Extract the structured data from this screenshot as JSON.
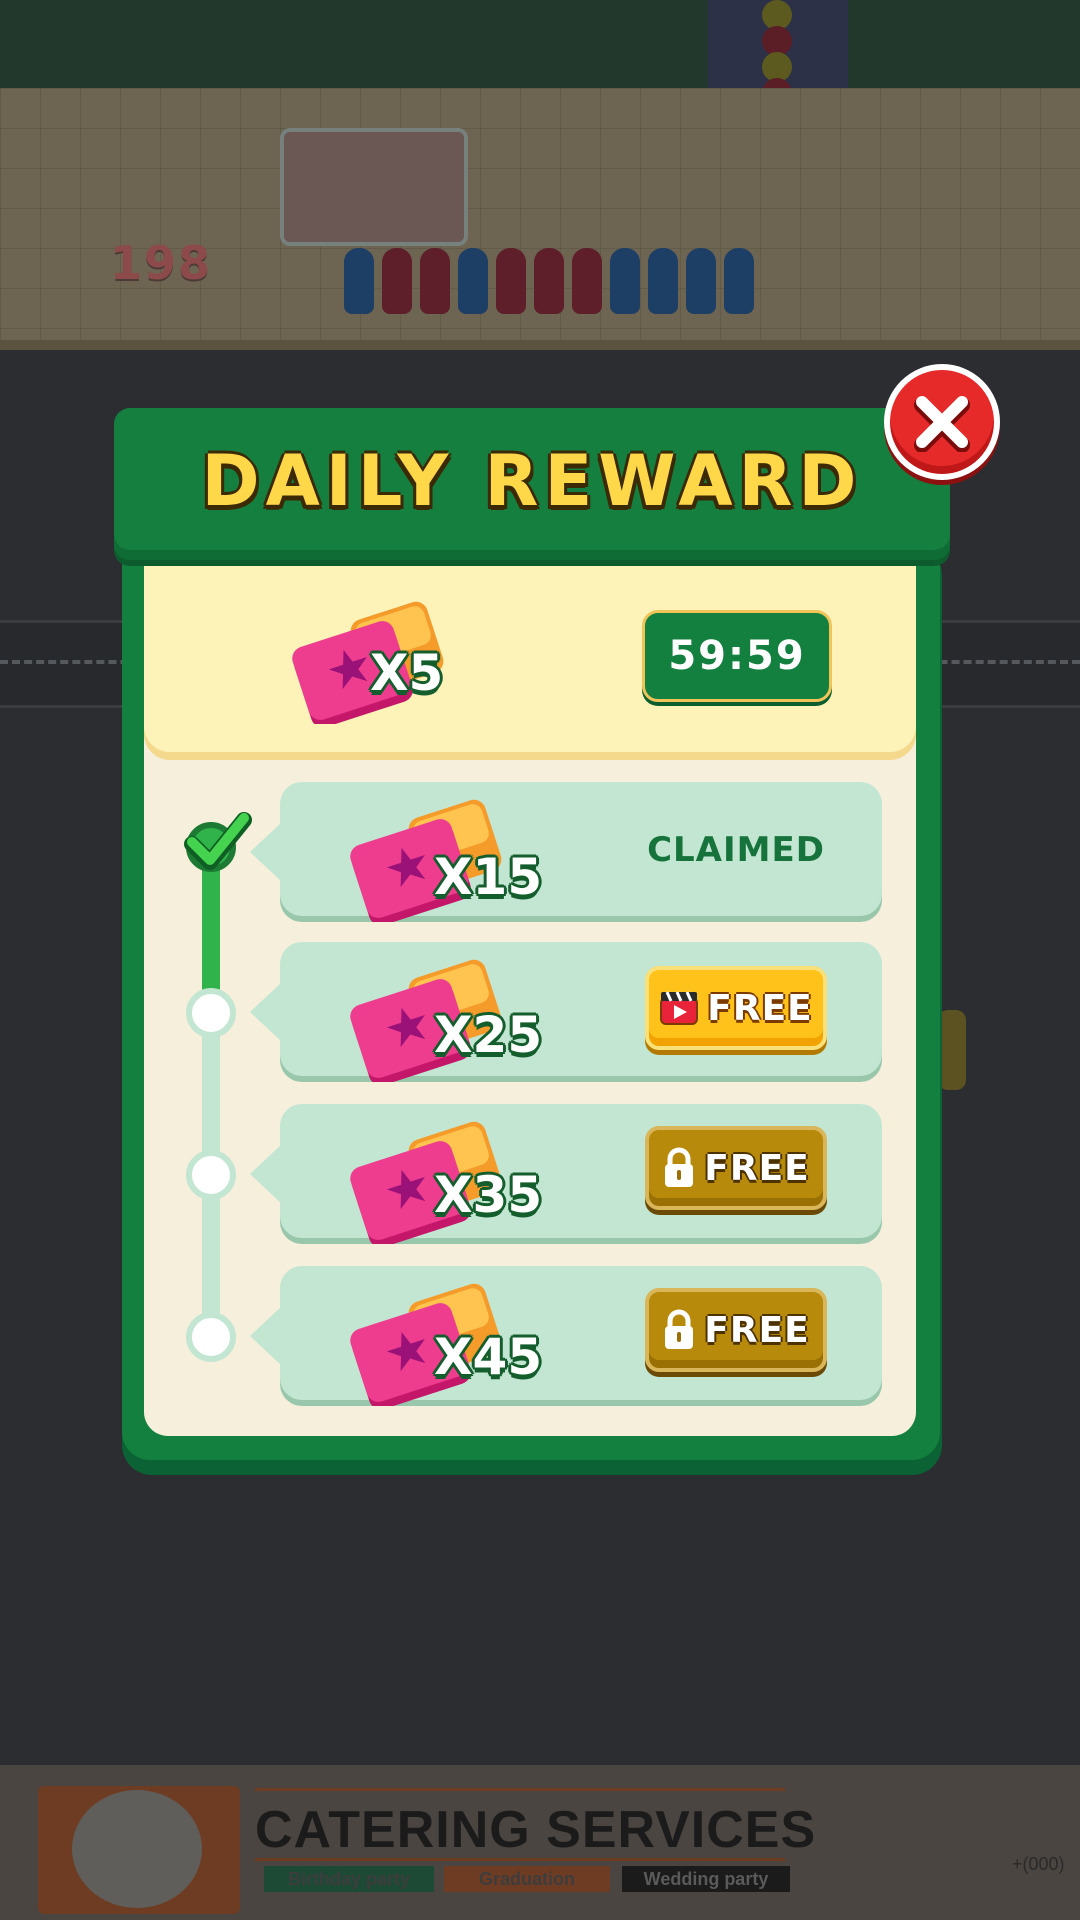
{
  "background": {
    "score": "198",
    "ad": {
      "title": "CATERING SERVICES",
      "tags": [
        "Birthday party",
        "Graduation",
        "Wedding party"
      ],
      "phone": "+(000)"
    }
  },
  "dialog": {
    "title": "DAILY REWARD",
    "close_label": "X",
    "featured": {
      "count": "X5",
      "timer": "59:59"
    },
    "rewards": [
      {
        "count": "X15",
        "status": "CLAIMED",
        "state": "claimed"
      },
      {
        "count": "X25",
        "button": "FREE",
        "state": "available",
        "icon": "video-ad-icon"
      },
      {
        "count": "X35",
        "button": "FREE",
        "state": "locked",
        "icon": "lock-icon"
      },
      {
        "count": "X45",
        "button": "FREE",
        "state": "locked",
        "icon": "lock-icon"
      }
    ],
    "colors": {
      "frame_green": "#14803f",
      "title_yellow": "#ffd84a",
      "close_red": "#e62a2a",
      "free_active": "#ffc21a",
      "free_locked": "#b88a0b",
      "row_mint": "#c2e6d2"
    }
  }
}
